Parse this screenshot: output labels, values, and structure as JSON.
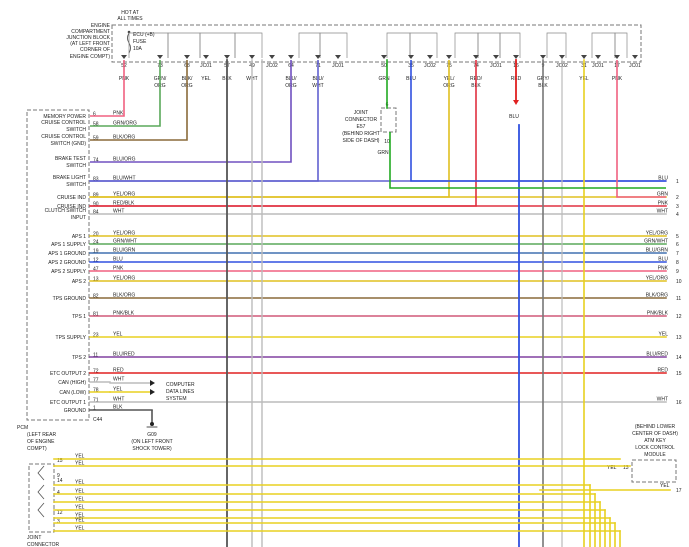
{
  "junction_block": {
    "lines": [
      "HOT AT",
      "ALL TIMES",
      "ENGINE",
      "COMPARTMENT",
      "JUNCTION BLOCK",
      "(AT LEFT FRONT",
      "CORNER OF",
      "ENGINE COMPT)"
    ],
    "fuse": [
      "ECU (+B)",
      "FUSE",
      "10A"
    ],
    "terminals": [
      {
        "label": "52",
        "wire": [
          "PNK"
        ],
        "color": "#f06080"
      },
      {
        "label": "73",
        "wire": [
          "GRN/",
          "ORG"
        ],
        "color": "#5aa85a"
      },
      {
        "label": "68",
        "wire": [
          "BLK/",
          "ORG"
        ],
        "color": "#8a6a3a"
      },
      {
        "label": "JC01",
        "wire": [
          "YEL"
        ],
        "color": "#e8d020"
      },
      {
        "label": "57",
        "wire": [
          "BLK"
        ],
        "color": "#555555"
      },
      {
        "label": "49",
        "wire": [
          "WHT"
        ],
        "color": "#999999"
      },
      {
        "label": "JC02",
        "wire": [],
        "color": "#999999"
      },
      {
        "label": "64",
        "wire": [
          "BLU/",
          "ORG"
        ],
        "color": "#7050c0"
      },
      {
        "label": "71",
        "wire": [
          "BLU/",
          "WHT"
        ],
        "color": "#6060d0"
      },
      {
        "label": "JC01",
        "wire": [],
        "color": "#e8d020"
      },
      {
        "label": "50",
        "wire": [
          "GRN"
        ],
        "color": "#22aa22"
      },
      {
        "label": "35",
        "wire": [
          "BLU"
        ],
        "color": "#3050e0"
      },
      {
        "label": "JC02",
        "wire": [],
        "color": "#999999"
      },
      {
        "label": "75",
        "wire": [
          "YEL/",
          "ORG"
        ],
        "color": "#e0c020"
      },
      {
        "label": "74",
        "wire": [
          "RED/",
          "BLK"
        ],
        "color": "#e03040"
      },
      {
        "label": "JC01",
        "wire": [],
        "color": "#e8d020"
      },
      {
        "label": "16",
        "wire": [
          "RED"
        ],
        "color": "#e02020"
      },
      {
        "label": "9",
        "wire": [
          "GRY/",
          "BLK"
        ],
        "color": "#777777"
      },
      {
        "label": "JC02",
        "wire": [],
        "color": "#999999"
      },
      {
        "label": "31",
        "wire": [
          "YEL"
        ],
        "color": "#e8d020"
      },
      {
        "label": "JC01",
        "wire": [],
        "color": "#e8d020"
      },
      {
        "label": "17",
        "wire": [
          "PNK"
        ],
        "color": "#f06080"
      },
      {
        "label": "JC01",
        "wire": [],
        "color": "#e8d020"
      }
    ]
  },
  "joint_connector_e57": {
    "lines": [
      "JOINT",
      "CONNECTOR",
      "E57",
      "(BEHIND RIGHT",
      "SIDE OF DASH)"
    ],
    "pin_top": "6",
    "pin_bottom": "10",
    "wire_below": "GRN",
    "blu_label": "BLU"
  },
  "pcm": {
    "label_lines": [
      "PCM",
      "(LEFT REAR",
      "OF ENGINE",
      "COMPT)"
    ],
    "connector": "C44",
    "rows": [
      {
        "name": [
          "MEMORY POWER"
        ],
        "pin": "6",
        "wire": "PNK",
        "end_wire": "",
        "end_num": "",
        "color": "#f06080"
      },
      {
        "name": [
          "CRUISE CONTROL",
          "SWITCH"
        ],
        "pin": "58",
        "wire": "GRN/ORG",
        "end_wire": "",
        "end_num": "",
        "color": "#5aa85a"
      },
      {
        "name": [
          "CRUISE CONTROL",
          "SWITCH (GND)"
        ],
        "pin": "59",
        "wire": "BLK/ORG",
        "end_wire": "",
        "end_num": "",
        "color": "#8a6a3a"
      },
      {
        "name": [
          "BRAKE TEST",
          "SWITCH"
        ],
        "pin": "74",
        "wire": "BLU/ORG",
        "end_wire": "",
        "end_num": "",
        "color": "#7050c0"
      },
      {
        "name": [
          "BRAKE LIGHT",
          "SWITCH"
        ],
        "pin": "83",
        "wire": "BLU/WHT",
        "end_wire": "BLU",
        "end_num": "1",
        "color": "#6060d0"
      },
      {
        "name": [
          "CRUISE IND"
        ],
        "pin": "89",
        "wire": "YEL/ORG",
        "end_wire": "GRN",
        "end_num": "2",
        "color": "#e0c020"
      },
      {
        "name": [
          "CRUISE IND"
        ],
        "pin": "90",
        "wire": "RED/BLK",
        "end_wire": "PNK",
        "end_num": "3",
        "color": "#e03040"
      },
      {
        "name": [
          "CLUTCH SWITCH",
          "INPUT"
        ],
        "pin": "84",
        "wire": "WHT",
        "end_wire": "WHT",
        "end_num": "4",
        "color": "#bbbbbb"
      },
      {
        "name": [
          "APS 1"
        ],
        "pin": "20",
        "wire": "YEL/ORG",
        "end_wire": "YEL/ORG",
        "end_num": "5",
        "color": "#e0c020"
      },
      {
        "name": [
          "APS 1 SUPPLY"
        ],
        "pin": "24",
        "wire": "GRN/WHT",
        "end_wire": "GRN/WHT",
        "end_num": "6",
        "color": "#5aa85a"
      },
      {
        "name": [
          "APS 1 GROUND"
        ],
        "pin": "19",
        "wire": "BLU/GRN",
        "end_wire": "BLU/GRN",
        "end_num": "7",
        "color": "#4070b0"
      },
      {
        "name": [
          "APS 2 GROUND"
        ],
        "pin": "12",
        "wire": "BLU",
        "end_wire": "BLU",
        "end_num": "8",
        "color": "#3050e0"
      },
      {
        "name": [
          "APS 2 SUPPLY"
        ],
        "pin": "47",
        "wire": "PNK",
        "end_wire": "PNK",
        "end_num": "9",
        "color": "#f06080"
      },
      {
        "name": [
          "APS 2"
        ],
        "pin": "13",
        "wire": "YEL/ORG",
        "end_wire": "YEL/ORG",
        "end_num": "10",
        "color": "#e0c020"
      },
      {
        "name": [
          "TPS GROUND"
        ],
        "pin": "82",
        "wire": "BLK/ORG",
        "end_wire": "BLK/ORG",
        "end_num": "11",
        "color": "#8a6a3a"
      },
      {
        "name": [
          "TPS 1"
        ],
        "pin": "81",
        "wire": "PNK/BLK",
        "end_wire": "PNK/BLK",
        "end_num": "12",
        "color": "#d05878"
      },
      {
        "name": [
          "TPS SUPPLY"
        ],
        "pin": "23",
        "wire": "YEL",
        "end_wire": "YEL",
        "end_num": "13",
        "color": "#e8d020"
      },
      {
        "name": [
          "TPS 2"
        ],
        "pin": "11",
        "wire": "BLU/RED",
        "end_wire": "BLU/RED",
        "end_num": "14",
        "color": "#8040a0"
      },
      {
        "name": [
          "ETC OUTPUT 2"
        ],
        "pin": "72",
        "wire": "RED",
        "end_wire": "RED",
        "end_num": "15",
        "color": "#e02020"
      },
      {
        "name": [
          "CAN (HIGH)"
        ],
        "pin": "77",
        "wire": "WHT",
        "end_wire": "",
        "end_num": "",
        "color": "#bbbbbb"
      },
      {
        "name": [
          "CAN (LOW)"
        ],
        "pin": "78",
        "wire": "YEL",
        "end_wire": "",
        "end_num": "",
        "color": "#e8d020"
      },
      {
        "name": [
          "ETC OUTPUT 1"
        ],
        "pin": "71",
        "wire": "WHT",
        "end_wire": "WHT",
        "end_num": "16",
        "color": "#bbbbbb"
      },
      {
        "name": [
          "GROUND"
        ],
        "pin": "1",
        "wire": "BLK",
        "end_wire": "",
        "end_num": "",
        "color": "#555555"
      }
    ]
  },
  "computer_data_lines": [
    "COMPUTER",
    "DATA LINES",
    "SYSTEM"
  ],
  "ground": {
    "lines": [
      "G09",
      "(ON LEFT FRONT",
      "SHOCK TOWER)"
    ]
  },
  "lock_module": {
    "lines": [
      "(BEHIND LOWER",
      "CENTER OF DASH)",
      "ATM KEY",
      "LOCK CONTROL",
      "MODULE"
    ],
    "pin": "13",
    "wire": "YEL",
    "end_wire": "YEL",
    "end_num": "17"
  },
  "joint_connector_bottom": {
    "lines": [
      "JOINT",
      "CONNECTOR"
    ],
    "pins": [
      "15",
      "9",
      "14",
      "4",
      "12",
      "3"
    ],
    "wires": [
      "YEL",
      "YEL",
      "YEL",
      "YEL",
      "YEL",
      "YEL",
      "YEL",
      "YEL",
      "YEL"
    ]
  }
}
